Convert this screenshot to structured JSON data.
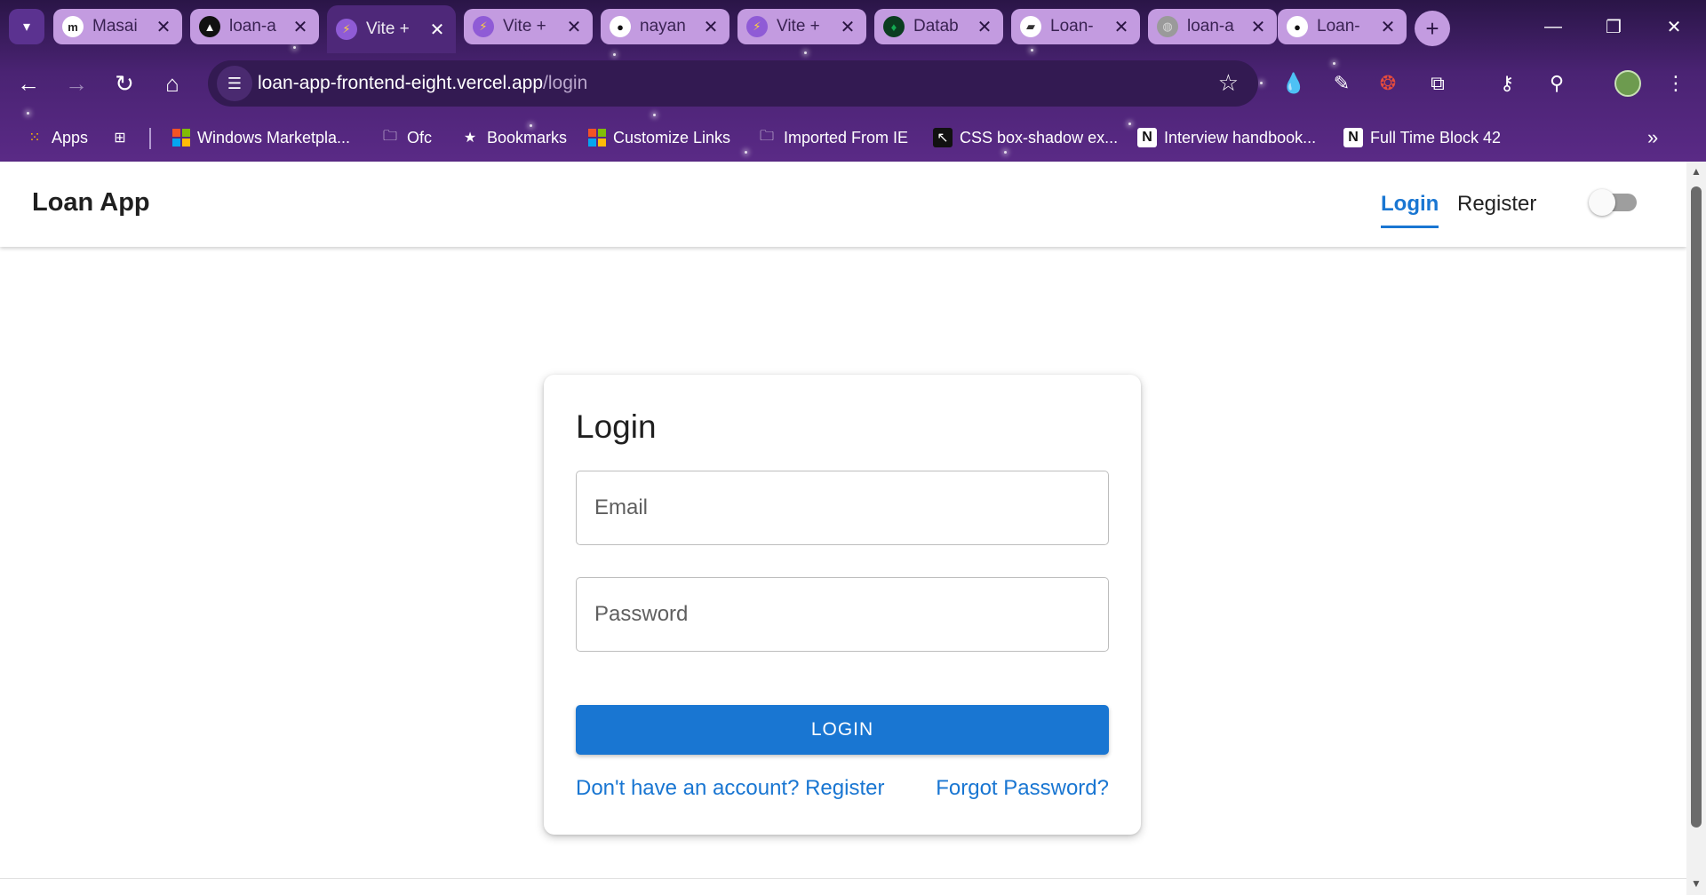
{
  "browser": {
    "tabs": [
      {
        "title": "Masai",
        "favicon": "m",
        "favicon_color": "#ffffff",
        "favicon_text_color": "#222222"
      },
      {
        "title": "loan-a",
        "favicon": "▲",
        "favicon_color": "#111111",
        "favicon_text_color": "#ffffff"
      },
      {
        "title": "Vite +",
        "favicon": "⚡",
        "favicon_color": "#8f5bd6",
        "favicon_text_color": "#ffd23f",
        "active": true
      },
      {
        "title": "Vite +",
        "favicon": "⚡",
        "favicon_color": "#8f5bd6",
        "favicon_text_color": "#ffd23f"
      },
      {
        "title": "nayan",
        "favicon": "●",
        "favicon_color": "#ffffff",
        "favicon_text_color": "#111111"
      },
      {
        "title": "Vite +",
        "favicon": "⚡",
        "favicon_color": "#8f5bd6",
        "favicon_text_color": "#ffd23f"
      },
      {
        "title": "Datab",
        "favicon": "♦",
        "favicon_color": "#0b3d20",
        "favicon_text_color": "#13aa52"
      },
      {
        "title": "Loan-",
        "favicon": "▰",
        "favicon_color": "#ffffff",
        "favicon_text_color": "#333333"
      },
      {
        "title": "loan-a",
        "favicon": "◍",
        "favicon_color": "#9a9a9a",
        "favicon_text_color": "#d6d6d6"
      },
      {
        "title": "Loan-",
        "favicon": "●",
        "favicon_color": "#ffffff",
        "favicon_text_color": "#111111"
      }
    ],
    "url_host": "loan-app-frontend-eight.vercel.app",
    "url_path": "/login",
    "bookmarks": {
      "apps": "Apps",
      "windows_marketplace": "Windows Marketpla...",
      "ofc": "Ofc",
      "bookmarks": "Bookmarks",
      "customize_links": "Customize Links",
      "imported_from_ie": "Imported From IE",
      "css_box_shadow": "CSS box-shadow ex...",
      "interview_handbook": "Interview handbook...",
      "full_time_block": "Full Time Block 42"
    },
    "colors": {
      "chrome_purple": "#4a2373",
      "tab_inactive": "#c39be0"
    }
  },
  "app": {
    "brand": "Loan App",
    "nav": {
      "login": "Login",
      "register": "Register"
    },
    "theme_toggle_on": false
  },
  "login_card": {
    "title": "Login",
    "email_placeholder": "Email",
    "password_placeholder": "Password",
    "submit_label": "LOGIN",
    "register_link": "Don't have an account? Register",
    "forgot_link": "Forgot Password?",
    "accent_color": "#1976d2"
  }
}
